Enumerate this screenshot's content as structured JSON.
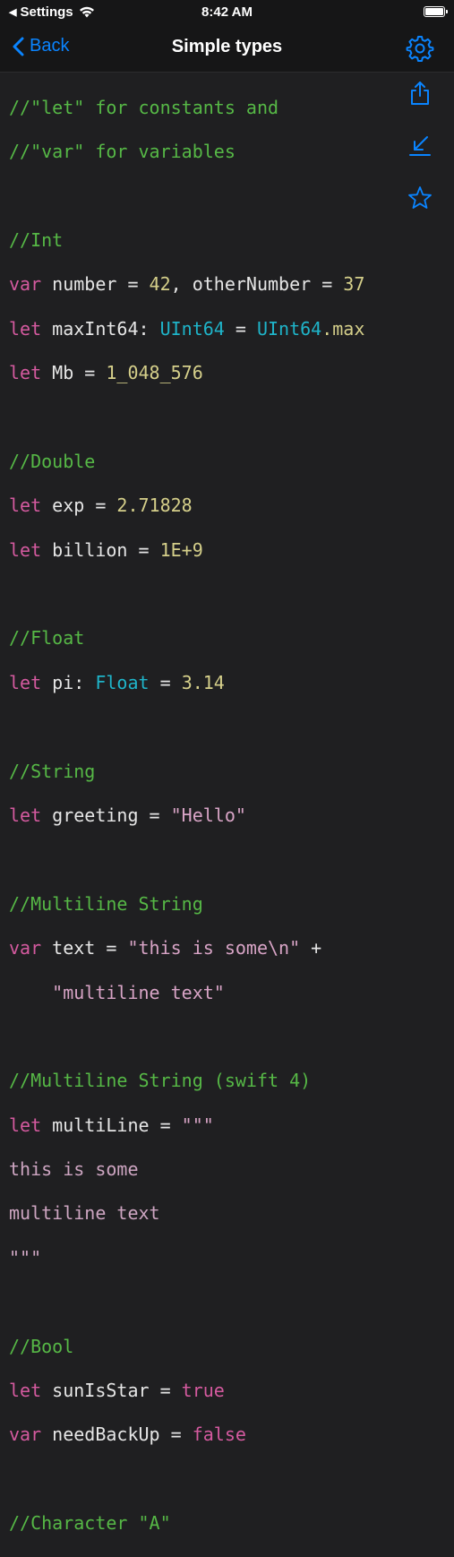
{
  "status": {
    "back_app": "Settings",
    "time": "8:42 AM"
  },
  "nav": {
    "back_label": "Back",
    "title": "Simple types"
  },
  "icons": {
    "settings": "gear-icon",
    "share": "share-icon",
    "collapse": "arrow-down-left-icon",
    "favorite": "star-icon"
  },
  "colors": {
    "accent": "#0a84ff",
    "comment": "#56b846",
    "keyword": "#d45a9f",
    "number": "#d5cf8a",
    "type": "#1fb4c9",
    "string": "#d8a4c6",
    "background": "#1f1f21"
  },
  "code": {
    "comments": {
      "c1": "//\"let\" for constants and",
      "c2": "//\"var\" for variables",
      "int": "//Int",
      "double": "//Double",
      "float": "//Float",
      "string": "//String",
      "multiline": "//Multiline String",
      "multiline4": "//Multiline String (swift 4)",
      "bool": "//Bool",
      "character": "//Character \"A\""
    },
    "kw": {
      "var": "var",
      "let": "let"
    },
    "tokens": {
      "number": " number = ",
      "n42": "42",
      "otherNumber": ", otherNumber = ",
      "n37": "37",
      "maxInt64": " maxInt64: ",
      "uint64": "UInt64",
      "eq": " = ",
      "max": ".max",
      "mb": " Mb = ",
      "n1048576": "1_048_576",
      "exp": " exp = ",
      "n271828": "2.71828",
      "billion": " billion = ",
      "n1e9": "1E+9",
      "pi": " pi: ",
      "floatT": "Float",
      "n314": "3.14",
      "greeting": " greeting = ",
      "hello": "\"Hello\"",
      "text": " text = ",
      "someStr": "\"this is some\\n\"",
      "plus": " +",
      "indent": "    ",
      "multilineText": "\"multiline text\"",
      "multiLine": " multiLine = ",
      "tripleQuote": "\"\"\"",
      "thisIsSome": "this is some",
      "multilineTextRaw": "multiline text",
      "sunIsStar": " sunIsStar = ",
      "trueV": "true",
      "needBackUp": " needBackUp = ",
      "falseV": "false"
    }
  }
}
